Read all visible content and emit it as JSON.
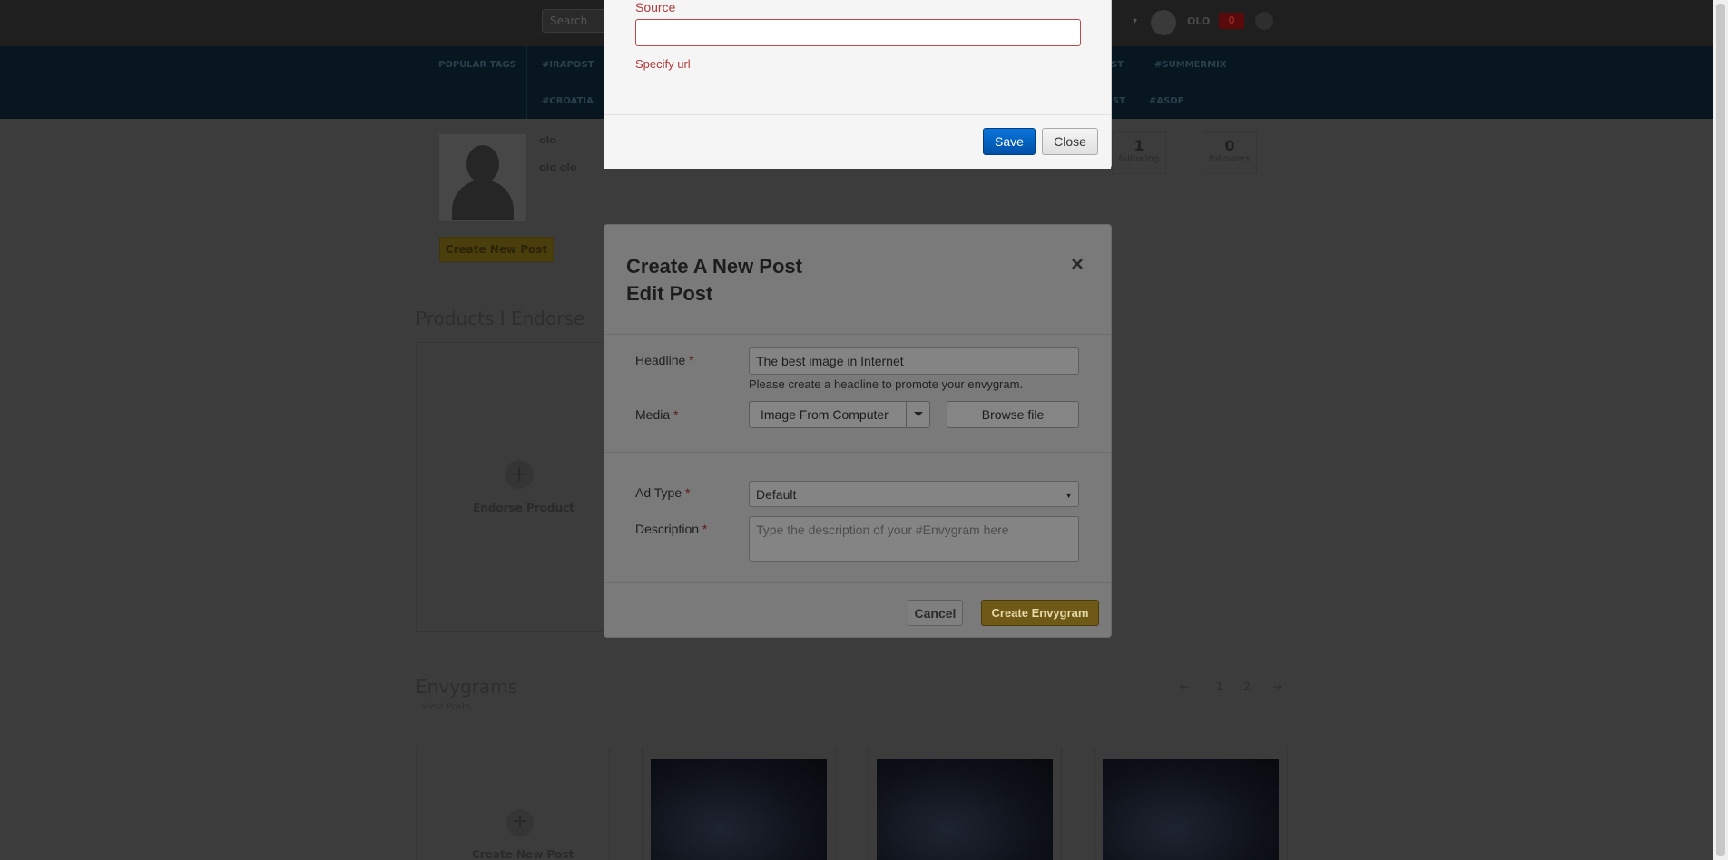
{
  "topbar": {
    "search_placeholder": "Search",
    "user_name": "OLO",
    "notification_count": "0"
  },
  "tagbar": {
    "label": "POPULAR TAGS",
    "tags_row1": [
      "#IRAPOST",
      "#SUMMERMIX"
    ],
    "tags_row2": [
      "#CROATIA",
      "#ASDF"
    ],
    "partial_tags": [
      "ST",
      "ST"
    ]
  },
  "profile": {
    "username": "olo",
    "fullname": "olo olo",
    "create_post_label": "Create New Post",
    "stats": [
      {
        "value": "1",
        "label": "following"
      },
      {
        "value": "0",
        "label": "followers"
      }
    ]
  },
  "products": {
    "title": "Products I Endorse",
    "endorse_label": "Endorse Product"
  },
  "envygrams": {
    "title": "Envygrams",
    "subtitle": "Latest Posts",
    "pager": [
      "←",
      "1",
      "2",
      "→"
    ],
    "add_label": "Create New Post"
  },
  "source_modal": {
    "label": "Source",
    "value": "",
    "error": "Specify url",
    "save_label": "Save",
    "close_label": "Close"
  },
  "post_modal": {
    "title_line1": "Create A New Post",
    "title_line2": "Edit Post",
    "close_symbol": "×",
    "headline_label": "Headline",
    "headline_value": "The best image in Internet",
    "headline_help": "Please create a headline to promote your envygram.",
    "media_label": "Media",
    "media_option": "Image From Computer",
    "browse_label": "Browse file",
    "ad_type_label": "Ad Type",
    "ad_type_value": "Default",
    "description_label": "Description",
    "description_placeholder": "Type the description of your #Envygram here",
    "cancel_label": "Cancel",
    "create_label": "Create Envygram",
    "required_mark": "*"
  }
}
